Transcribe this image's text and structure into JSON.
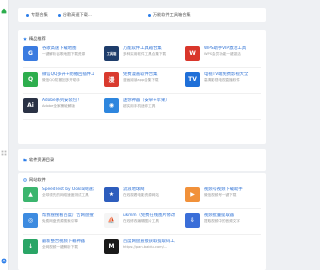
{
  "notice": {
    "items": [
      "专题合集",
      "谷歌高速下载...",
      "万能软件工具箱合集"
    ]
  },
  "sections": {
    "featured": "精品推荐",
    "directory": "软件资源目录",
    "web": "网站软件"
  },
  "featured_cards": [
    {
      "title": "谷歌高速下载地图",
      "desc": "一键解析谷歌地图下载资源",
      "color": "#3a7be0",
      "glyph": "G"
    },
    {
      "title": "万能软件工具箱合集",
      "desc": "多种实用软件工具合集下载",
      "color": "#1e3d6b",
      "glyph": "工具箱"
    },
    {
      "title": "WPS助手VIP激活工具",
      "desc": "WPS会员功能一键激活",
      "color": "#d9362b",
      "glyph": "W"
    },
    {
      "title": "微信QQ多开+防撤回插件工具",
      "desc": "微信QQ防撤回多开助手",
      "color": "#2dae4d",
      "glyph": "Q"
    },
    {
      "title": "免费漫画软件合集",
      "desc": "漫画阅读app合集下载",
      "color": "#d93a2e",
      "glyph": "漫"
    },
    {
      "title": "电视TV端免费影视大全",
      "desc": "高清影视电视直播软件",
      "color": "#1f6fd8",
      "glyph": "TV"
    },
    {
      "title": "Adobe系列安装包！",
      "desc": "Adobe全家桶破解版",
      "color": "#2a3245",
      "glyph": "Ai"
    },
    {
      "title": "迷你神器（安卓+苹果）",
      "desc": "超实用手机迷你工具",
      "color": "#2e86de",
      "glyph": "◉"
    }
  ],
  "web_cards": [
    {
      "title": "SpeedTest by Ookla网速测试",
      "desc": "全球领先的网络速度测试工具",
      "color": "#3bb56e",
      "glyph": "▲"
    },
    {
      "title": "流浪地球网",
      "desc": "在线观看电影资源网站",
      "color": "#2d5dbd",
      "glyph": "★"
    },
    {
      "title": "视频号视频下载助手",
      "desc": "微信视频号一键下载",
      "color": "#f1913a",
      "glyph": "▶"
    },
    {
      "title": "帮我搜搜看百度广告网盘搜索",
      "desc": "免费网盘资源搜索引擎",
      "color": "#3d8be0",
      "glyph": "◎"
    },
    {
      "title": "ukmm（免费在线图片修改器）",
      "desc": "在线修改编辑图片工具",
      "color": "#f5f5f5",
      "glyph": "⛵"
    },
    {
      "title": "视频批量提取器",
      "desc": "提取视频中的音频文字",
      "color": "#3a6ed8",
      "glyph": "⇩"
    },
    {
      "title": "最新整合视频下载神器",
      "desc": "全网视频一键解析下载",
      "color": "#2aa566",
      "glyph": "↓"
    },
    {
      "title": "百度网盘直接获取提取码工具",
      "desc": "https://pan.baidu.com/...",
      "color": "#1a1a1a",
      "glyph": "M"
    },
    {
      "title": "",
      "desc": "",
      "color": "#ffffff",
      "glyph": ""
    }
  ],
  "leftbar": {
    "bottom_text": "↑"
  }
}
